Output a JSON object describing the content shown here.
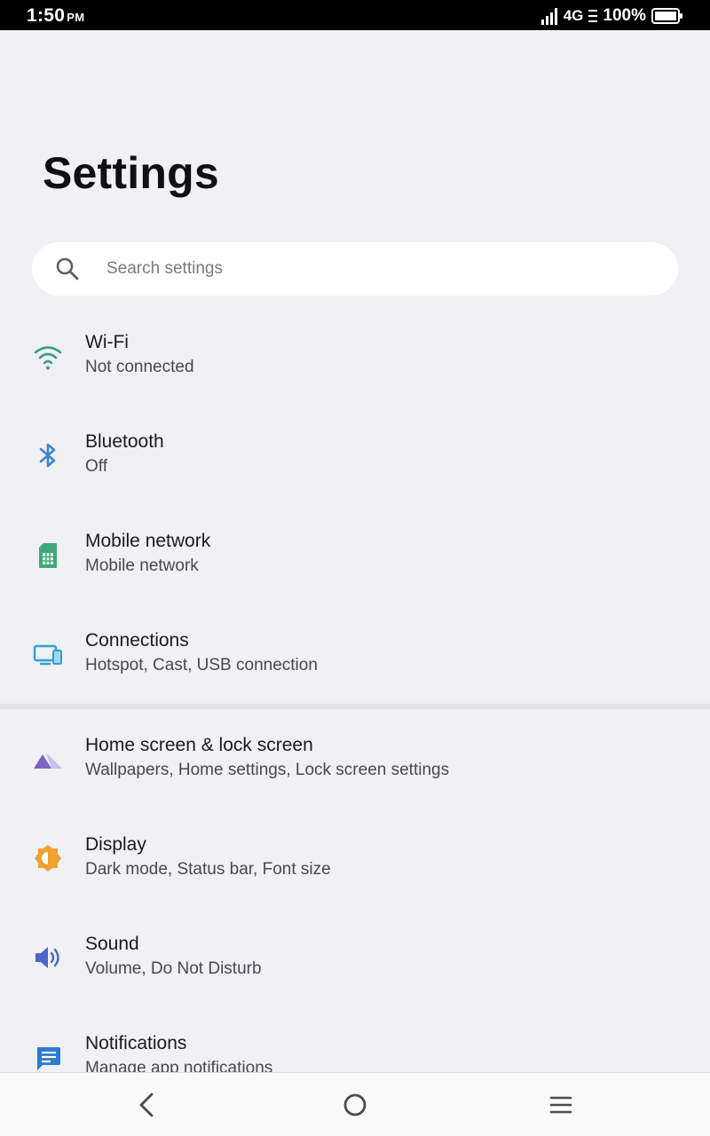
{
  "status_bar": {
    "time": "1:50",
    "ampm": "PM",
    "network": "4G",
    "battery": "100%"
  },
  "page": {
    "title": "Settings"
  },
  "search": {
    "placeholder": "Search settings"
  },
  "settings": [
    {
      "title": "Wi-Fi",
      "subtitle": "Not connected",
      "icon": "wifi-icon",
      "color": "#3a9c8c"
    },
    {
      "title": "Bluetooth",
      "subtitle": "Off",
      "icon": "bluetooth-icon",
      "color": "#3b86d0"
    },
    {
      "title": "Mobile network",
      "subtitle": "Mobile network",
      "icon": "sim-card-icon",
      "color": "#3fa87a"
    },
    {
      "title": "Connections",
      "subtitle": "Hotspot, Cast, USB connection",
      "icon": "devices-icon",
      "color": "#2f9fd4"
    },
    {
      "title": "Home screen & lock screen",
      "subtitle": "Wallpapers, Home settings, Lock screen settings",
      "icon": "wallpaper-icon",
      "color": "#7c64c4"
    },
    {
      "title": "Display",
      "subtitle": "Dark mode, Status bar, Font size",
      "icon": "brightness-icon",
      "color": "#f0a030"
    },
    {
      "title": "Sound",
      "subtitle": "Volume, Do Not Disturb",
      "icon": "speaker-icon",
      "color": "#4a66c8"
    },
    {
      "title": "Notifications",
      "subtitle": "Manage app notifications",
      "icon": "notification-icon",
      "color": "#2c7ad4"
    }
  ],
  "nav": {
    "back": "back-icon",
    "home": "home-icon",
    "menu": "menu-icon"
  }
}
